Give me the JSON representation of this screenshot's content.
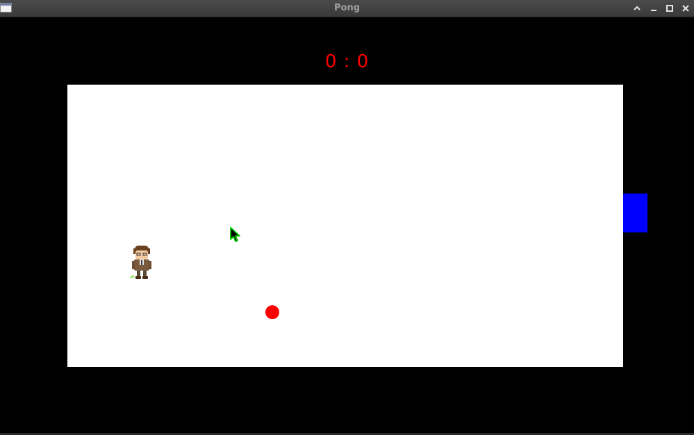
{
  "window": {
    "title": "Pong",
    "icons": {
      "app": "app-window-icon",
      "shade": "chevron-up-icon",
      "minimize": "minimize-icon",
      "maximize": "maximize-icon",
      "close": "close-icon"
    }
  },
  "score": {
    "text": "0 : 0",
    "left": 0,
    "right": 0
  },
  "colors": {
    "background": "#000000",
    "field": "#ffffff",
    "score": "#ff0000",
    "ball": "#ff0000",
    "paddle": "#0000ff",
    "cursor_outline": "#00cc00"
  },
  "sprites": {
    "player": "character-sprite",
    "cursor": "mouse-cursor-icon"
  }
}
